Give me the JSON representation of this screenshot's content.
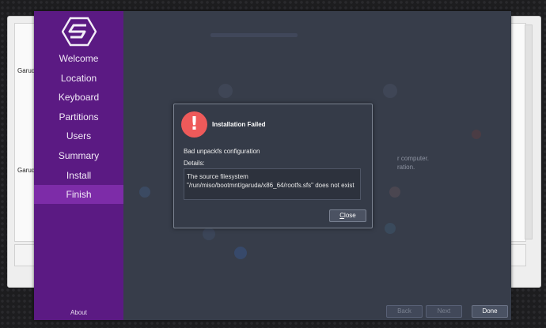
{
  "background_window": {
    "labels": [
      "Garud",
      "Garud"
    ]
  },
  "sidebar": {
    "items": [
      {
        "label": "Welcome"
      },
      {
        "label": "Location"
      },
      {
        "label": "Keyboard"
      },
      {
        "label": "Partitions"
      },
      {
        "label": "Users"
      },
      {
        "label": "Summary"
      },
      {
        "label": "Install"
      },
      {
        "label": "Finish",
        "active": true
      }
    ],
    "about_label": "About",
    "accent_color": "#5b1a83",
    "active_color": "#7d2ca8"
  },
  "content": {
    "ghost_text_1": "r computer.",
    "ghost_text_2": "ration."
  },
  "footer": {
    "back_label": "Back",
    "next_label": "Next",
    "done_label": "Done"
  },
  "dialog": {
    "icon": "exclamation-icon",
    "title": "Installation Failed",
    "message": "Bad unpackfs configuration",
    "details_label": "Details:",
    "details_text": "The source filesystem \"/run/miso/bootmnt/garuda/x86_64/rootfs.sfs\" does not exist",
    "close_label_underlined": "C",
    "close_label_rest": "lose",
    "icon_color": "#ee5a5a"
  }
}
